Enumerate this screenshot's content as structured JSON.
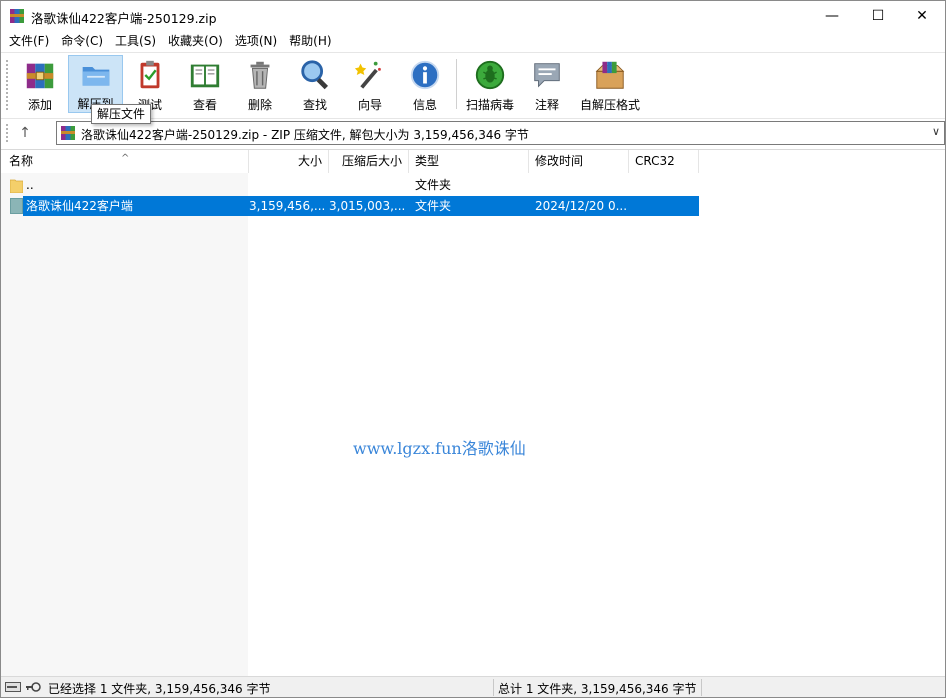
{
  "window": {
    "title": "洛歌诛仙422客户端-250129.zip",
    "controls": {
      "minimize": "—",
      "maximize": "☐",
      "close": "✕"
    }
  },
  "menu": [
    "文件(F)",
    "命令(C)",
    "工具(S)",
    "收藏夹(O)",
    "选项(N)",
    "帮助(H)"
  ],
  "toolbar": {
    "add": "添加",
    "extract_to": "解压到",
    "test": "测试",
    "view": "查看",
    "delete": "删除",
    "find": "查找",
    "wizard": "向导",
    "info": "信息",
    "virus_scan": "扫描病毒",
    "comment": "注释",
    "sfx": "自解压格式"
  },
  "tooltip": "解压文件",
  "address": {
    "up": "↑",
    "text": "洛歌诛仙422客户端-250129.zip - ZIP 压缩文件, 解包大小为 3,159,456,346 字节",
    "dropdown": "∨"
  },
  "columns": {
    "name": "名称",
    "size": "大小",
    "packed": "压缩后大小",
    "type": "类型",
    "modified": "修改时间",
    "crc": "CRC32"
  },
  "rows": [
    {
      "name": "..",
      "size": "",
      "packed": "",
      "type": "文件夹",
      "modified": ""
    },
    {
      "name": "洛歌诛仙422客户端",
      "size": "3,159,456,...",
      "packed": "3,015,003,...",
      "type": "文件夹",
      "modified": "2024/12/20 0..."
    }
  ],
  "watermark": "www.lgzx.fun洛歌诛仙",
  "status": {
    "left": "已经选择 1 文件夹, 3,159,456,346 字节",
    "right": "总计 1 文件夹, 3,159,456,346 字节"
  },
  "colors": {
    "selection": "#0078d7",
    "watermark": "#3a86d9",
    "active_button": "#cce4f7"
  }
}
